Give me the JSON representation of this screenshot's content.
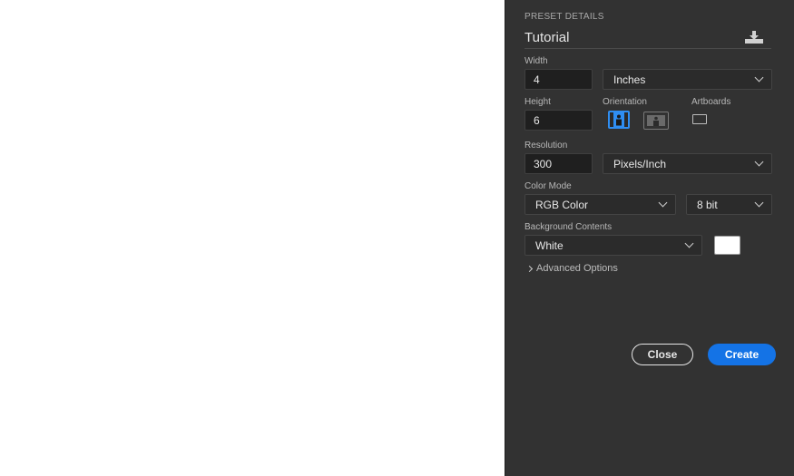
{
  "panel": {
    "section_title": "PRESET DETAILS",
    "preset_name": "Tutorial",
    "save_preset_icon": "download-icon",
    "width": {
      "label": "Width",
      "value": "4",
      "unit": "Inches"
    },
    "height": {
      "label": "Height",
      "value": "6"
    },
    "orientation": {
      "label": "Orientation",
      "selected": "portrait",
      "portrait_icon": "portrait-icon",
      "landscape_icon": "landscape-icon"
    },
    "artboards": {
      "label": "Artboards",
      "checked": false
    },
    "resolution": {
      "label": "Resolution",
      "value": "300",
      "unit": "Pixels/Inch"
    },
    "color_mode": {
      "label": "Color Mode",
      "mode": "RGB Color",
      "bits": "8 bit"
    },
    "background": {
      "label": "Background Contents",
      "value": "White",
      "swatch_color": "#ffffff"
    },
    "advanced": {
      "label": "Advanced Options"
    },
    "buttons": {
      "close": "Close",
      "create": "Create"
    }
  },
  "colors": {
    "panel_bg": "#323232",
    "accent": "#1473e6"
  }
}
